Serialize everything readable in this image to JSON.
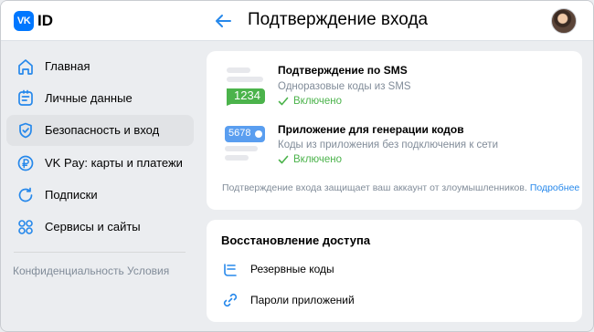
{
  "header": {
    "logo_text": "ID",
    "logo_mark": "VK",
    "title": "Подтверждение входа"
  },
  "sidebar": {
    "items": [
      {
        "label": "Главная",
        "icon": "house-icon"
      },
      {
        "label": "Личные данные",
        "icon": "id-card-icon"
      },
      {
        "label": "Безопасность и вход",
        "icon": "shield-icon",
        "active": true
      },
      {
        "label": "VK Pay: карты и платежи",
        "icon": "ruble-icon"
      },
      {
        "label": "Подписки",
        "icon": "refresh-icon"
      },
      {
        "label": "Сервисы и сайты",
        "icon": "grid-icon"
      }
    ],
    "footer": {
      "privacy": "Конфиденциальность",
      "terms": "Условия"
    }
  },
  "confirmation": {
    "sms": {
      "code": "1234",
      "title": "Подтверждение по SMS",
      "description": "Одноразовые коды из SMS",
      "status": "Включено"
    },
    "app": {
      "code": "5678",
      "title": "Приложение для генерации кодов",
      "description": "Коды из приложения без подключения к сети",
      "status": "Включено"
    },
    "note": "Подтверждение входа защищает ваш аккаунт от злоумышленников.",
    "more_link": "Подробнее"
  },
  "recovery": {
    "title": "Восстановление доступа",
    "items": [
      {
        "label": "Резервные коды",
        "icon": "backup-codes-icon"
      },
      {
        "label": "Пароли приложений",
        "icon": "link-icon"
      }
    ]
  },
  "colors": {
    "accent": "#2688eb",
    "brand": "#0077ff",
    "success": "#4bb34b",
    "muted": "#818c99"
  }
}
